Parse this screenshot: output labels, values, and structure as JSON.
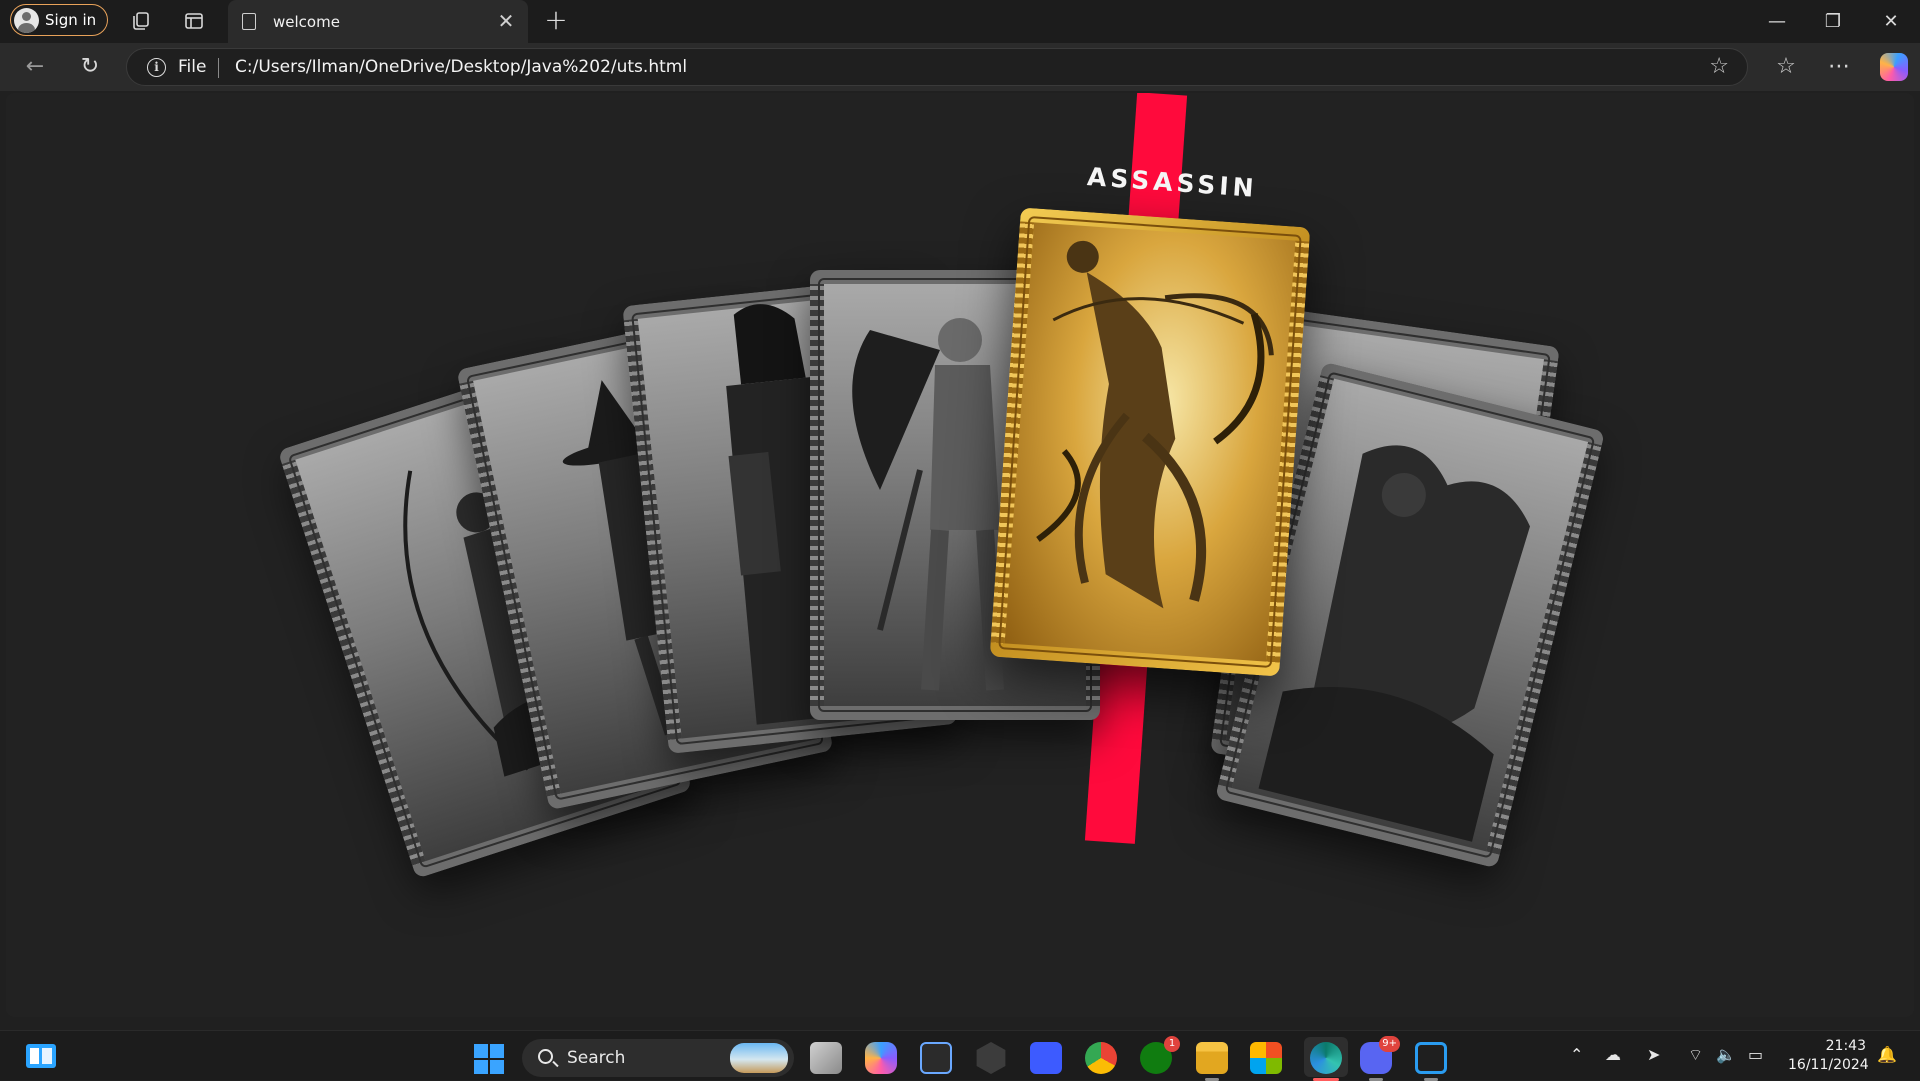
{
  "browser": {
    "signin_label": "Sign in",
    "tab_title": "welcome",
    "address": {
      "scheme": "File",
      "url": "C:/Users/Ilman/OneDrive/Desktop/Java%202/uts.html"
    }
  },
  "page": {
    "title": "ASSASSIN",
    "accent_color": "#ff0a3c",
    "highlight_color": "#d9a63e",
    "cards": [
      {
        "name": "archer-card",
        "tone": "grayscale"
      },
      {
        "name": "witch-card",
        "tone": "grayscale"
      },
      {
        "name": "hooded-monk-card",
        "tone": "grayscale"
      },
      {
        "name": "knight-card",
        "tone": "grayscale"
      },
      {
        "name": "assassin-card",
        "tone": "gold",
        "selected": true
      },
      {
        "name": "beast-card",
        "tone": "grayscale"
      },
      {
        "name": "brute-card",
        "tone": "grayscale"
      }
    ]
  },
  "taskbar": {
    "search_label": "Search",
    "badges": {
      "xbox": "1",
      "discord": "9+"
    },
    "clock_time": "21:43",
    "clock_date": "16/11/2024"
  }
}
